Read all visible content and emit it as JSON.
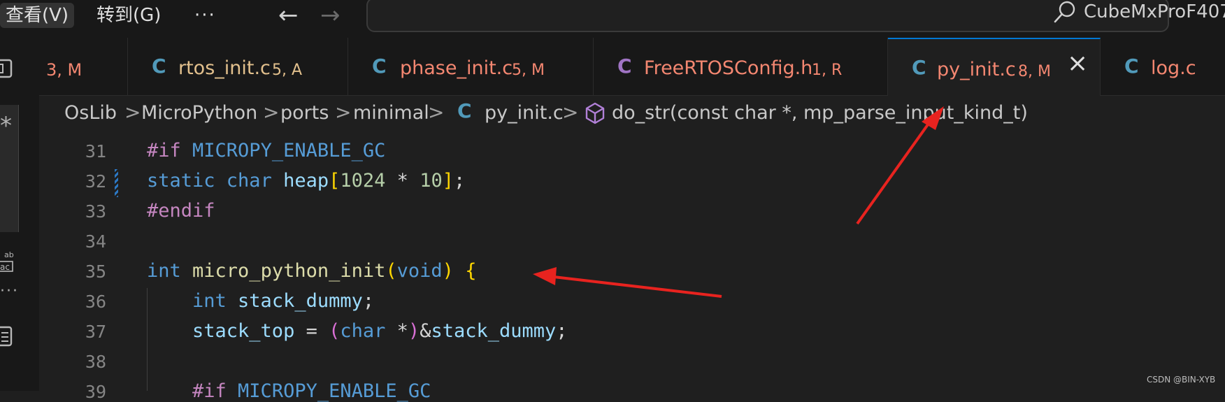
{
  "menubar": {
    "view": "查看(V)",
    "goto": "转到(G)",
    "more": "···"
  },
  "nav": {
    "back": "←",
    "forward": "→"
  },
  "search": {
    "text": "CubeMxProF407"
  },
  "tabs": [
    {
      "icon": "",
      "name": "",
      "status": "3, M"
    },
    {
      "icon": "C",
      "name": "rtos_init.c",
      "status": "5, A"
    },
    {
      "icon": "C",
      "name": "phase_init.c",
      "status": "5, M"
    },
    {
      "icon": "C",
      "name": "FreeRTOSConfig.h",
      "status": "1, R"
    },
    {
      "icon": "C",
      "name": "py_init.c",
      "status": "8, M",
      "close": "×"
    },
    {
      "icon": "C",
      "name": "log.c",
      "status": ""
    }
  ],
  "breadcrumb": {
    "items": [
      "OsLib",
      "MicroPython",
      "ports",
      "minimal",
      "py_init.c",
      "do_str(const char *, mp_parse_input_kind_t)"
    ],
    "file_icon": "C",
    "sep": ">"
  },
  "code": {
    "lines": [
      {
        "num": "31",
        "t": [
          [
            "#if ",
            "kw-purple"
          ],
          [
            "MICROPY_ENABLE_GC",
            "macro"
          ]
        ]
      },
      {
        "num": "32",
        "t": [
          [
            "static ",
            "kw-blue"
          ],
          [
            "char ",
            "kw-blue"
          ],
          [
            "heap",
            "var"
          ],
          [
            "[",
            "brk1"
          ],
          [
            "1024",
            "num"
          ],
          [
            " * ",
            "plain"
          ],
          [
            "10",
            "num"
          ],
          [
            "]",
            "brk1"
          ],
          [
            ";",
            "plain"
          ]
        ]
      },
      {
        "num": "33",
        "t": [
          [
            "#endif",
            "kw-purple"
          ]
        ]
      },
      {
        "num": "34",
        "t": []
      },
      {
        "num": "35",
        "t": [
          [
            "int ",
            "kw-blue"
          ],
          [
            "micro_python_init",
            "fn"
          ],
          [
            "(",
            "brk1"
          ],
          [
            "void",
            "kw-blue"
          ],
          [
            ")",
            "brk1"
          ],
          [
            " ",
            "plain"
          ],
          [
            "{",
            "brk1"
          ]
        ]
      },
      {
        "num": "36",
        "t": [
          [
            "    int ",
            "kw-blue"
          ],
          [
            "stack_dummy",
            "var"
          ],
          [
            ";",
            "plain"
          ]
        ]
      },
      {
        "num": "37",
        "t": [
          [
            "    stack_top",
            "var"
          ],
          [
            " = ",
            "plain"
          ],
          [
            "(",
            "brk2"
          ],
          [
            "char",
            "kw-blue"
          ],
          [
            " *",
            "plain"
          ],
          [
            ")",
            "brk2"
          ],
          [
            "&",
            "plain"
          ],
          [
            "stack_dummy",
            "var"
          ],
          [
            ";",
            "plain"
          ]
        ]
      },
      {
        "num": "38",
        "t": []
      },
      {
        "num": "39",
        "t": [
          [
            "    #if ",
            "kw-purple"
          ],
          [
            "MICROPY_ENABLE_GC",
            "macro"
          ]
        ]
      }
    ]
  },
  "watermark": "CSDN @BIN-XYB",
  "colors": {
    "accent": "#0078d4",
    "arrow": "#e8231f",
    "modified": "#e2c08d",
    "error": "#f48771",
    "c_icon": "#519aba",
    "h_icon": "#a074c4"
  },
  "icons": [
    "search-icon",
    "back-arrow-icon",
    "forward-arrow-icon",
    "close-icon",
    "symbol-method-icon",
    "c-file-icon",
    "h-file-icon",
    "explorer-icon",
    "search-sidebar-icon",
    "find-replace-icon",
    "more-icon",
    "outline-icon"
  ]
}
